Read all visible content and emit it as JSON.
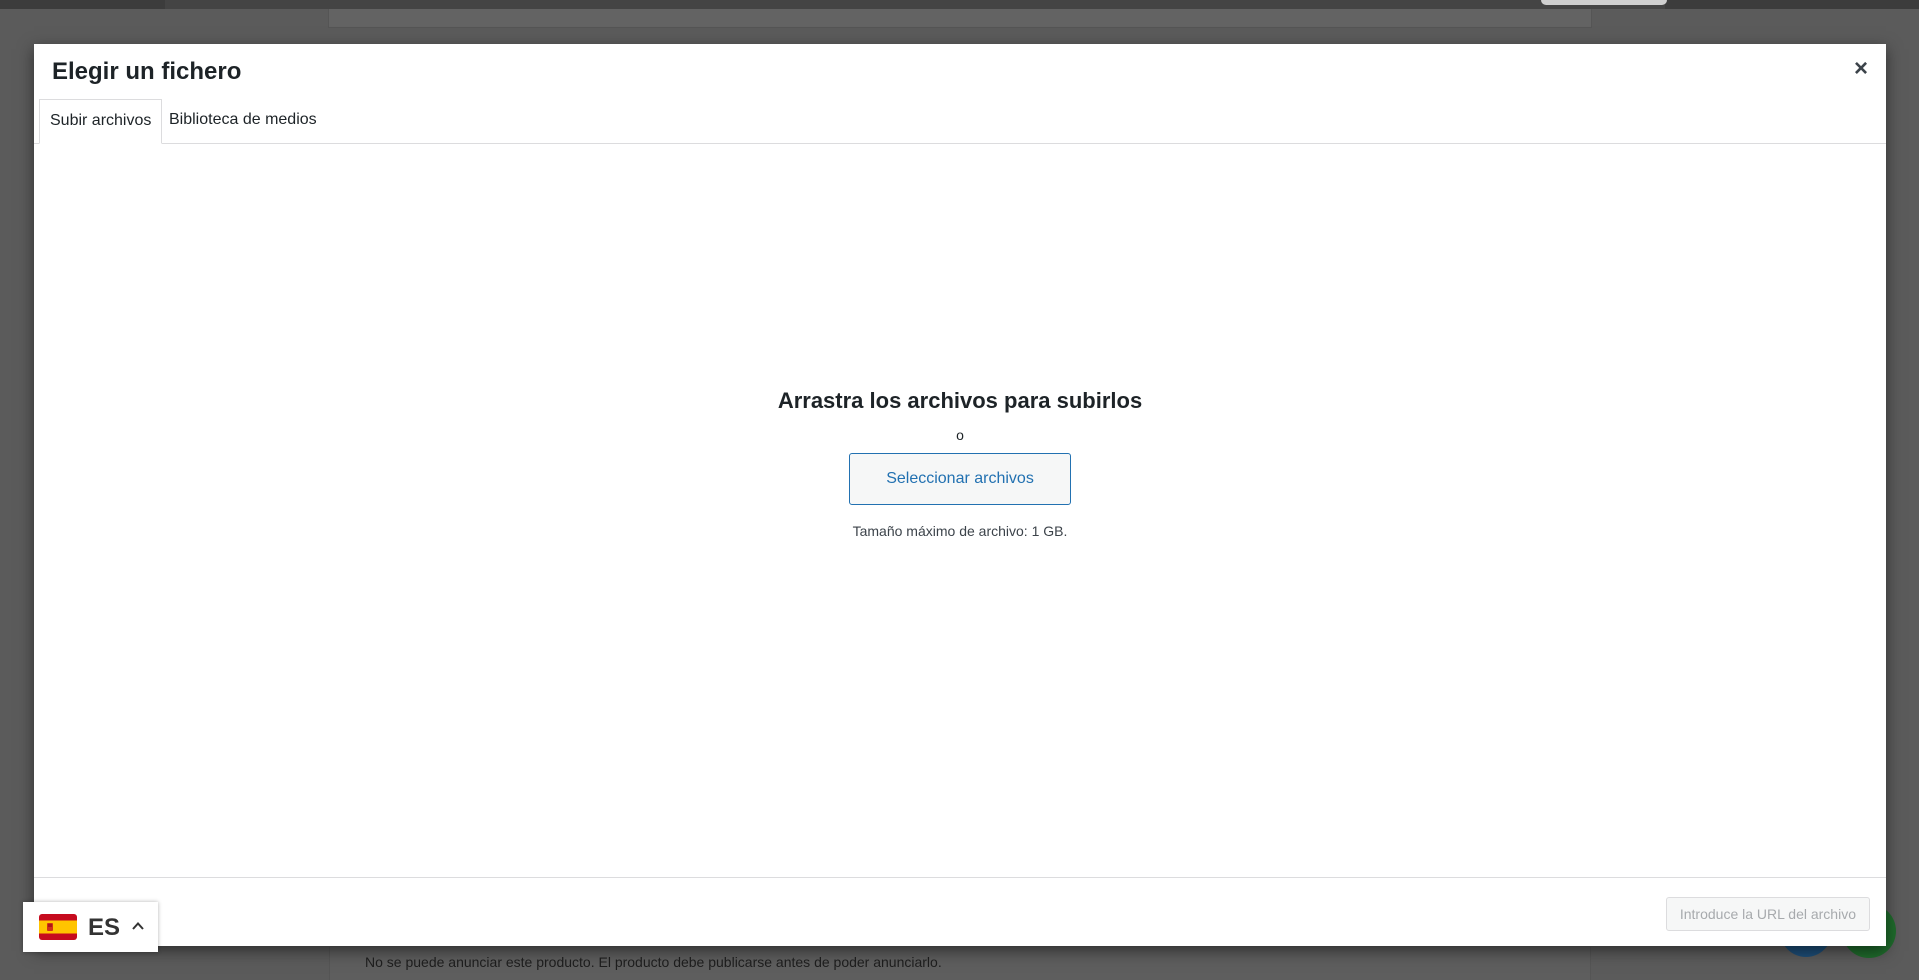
{
  "modal": {
    "title": "Elegir un fichero",
    "close_label": "×",
    "tabs": [
      {
        "label": "Subir archivos",
        "active": true
      },
      {
        "label": "Biblioteca de medios",
        "active": false
      }
    ],
    "upload": {
      "title": "Arrastra los archivos para subirlos",
      "or": "o",
      "select_button": "Seleccionar archivos",
      "max_size": "Tamaño máximo de archivo: 1 GB."
    },
    "toolbar": {
      "url_placeholder": "Introduce la URL del archivo"
    }
  },
  "background": {
    "notice": "No se puede anunciar este producto. El producto debe publicarse antes de poder anunciarlo."
  },
  "language_switcher": {
    "code": "ES",
    "flag_icon": "spain-flag-icon"
  },
  "colors": {
    "accent": "#2271b1",
    "text": "#1d2327",
    "border": "#dcdcde",
    "overlay": "#5b5b5b"
  }
}
